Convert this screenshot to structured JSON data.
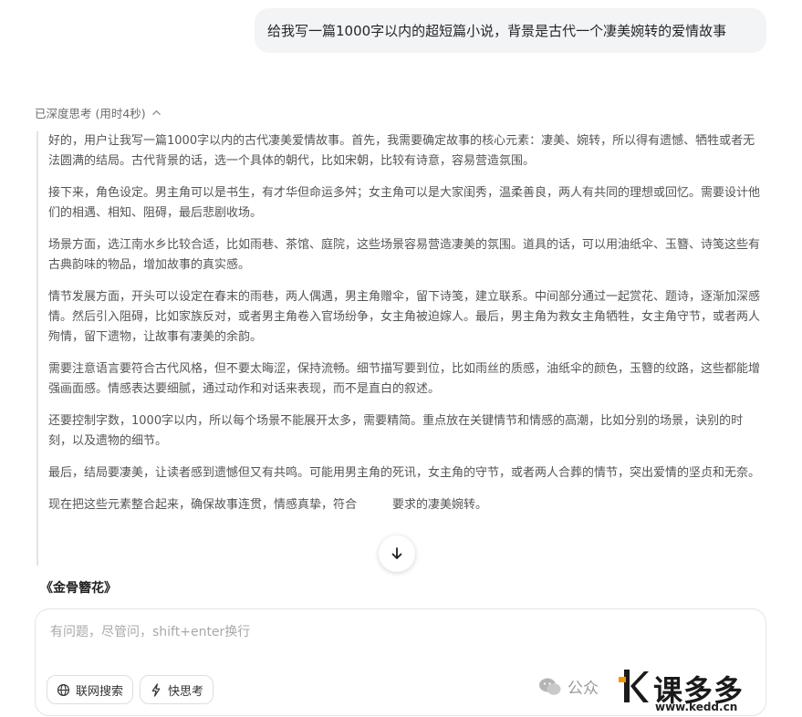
{
  "user_message": "给我写一篇1000字以内的超短篇小说，背景是古代一个凄美婉转的爱情故事",
  "thinking": {
    "header": "已深度思考 (用时4秒)",
    "paragraphs": [
      "好的，用户让我写一篇1000字以内的古代凄美爱情故事。首先，我需要确定故事的核心元素：凄美、婉转，所以得有遗憾、牺牲或者无法圆满的结局。古代背景的话，选一个具体的朝代，比如宋朝，比较有诗意，容易营造氛围。",
      "接下来，角色设定。男主角可以是书生，有才华但命运多舛；女主角可以是大家闺秀，温柔善良，两人有共同的理想或回忆。需要设计他们的相遇、相知、阻碍，最后悲剧收场。",
      "场景方面，选江南水乡比较合适，比如雨巷、茶馆、庭院，这些场景容易营造凄美的氛围。道具的话，可以用油纸伞、玉簪、诗笺这些有古典韵味的物品，增加故事的真实感。",
      "情节发展方面，开头可以设定在春末的雨巷，两人偶遇，男主角赠伞，留下诗笺，建立联系。中间部分通过一起赏花、题诗，逐渐加深感情。然后引入阻碍，比如家族反对，或者男主角卷入官场纷争，女主角被迫嫁人。最后，男主角为救女主角牺牲，女主角守节，或者两人殉情，留下遗物，让故事有凄美的余韵。",
      "需要注意语言要符合古代风格，但不要太晦涩，保持流畅。细节描写要到位，比如雨丝的质感，油纸伞的颜色，玉簪的纹路，这些都能增强画面感。情感表达要细腻，通过动作和对话来表现，而不是直白的叙述。",
      "还要控制字数，1000字以内，所以每个场景不能展开太多，需要精简。重点放在关键情节和情感的高潮，比如分别的场景，诀别的时刻，以及遗物的细节。",
      "最后，结局要凄美，让读者感到遗憾但又有共鸣。可能用男主角的死讯，女主角的守节，或者两人合葬的情节，突出爱情的坚贞和无奈。",
      "现在把这些元素整合起来，确保故事连贯，情感真挚，符合　　　要求的凄美婉转。"
    ]
  },
  "story_title": "《金骨簪花》",
  "composer": {
    "placeholder": "有问题，尽管问，shift+enter换行",
    "web_search_label": "联网搜索",
    "fast_think_label": "快思考"
  },
  "watermark": {
    "wechat_label": "公众",
    "brand": "课多多",
    "url": "www.kedd.cn"
  },
  "colors": {
    "bubble_bg": "#f3f4f6",
    "thinking_text": "#555555",
    "brand_orange": "#f39800",
    "brand_blue": "#1e73d8"
  }
}
